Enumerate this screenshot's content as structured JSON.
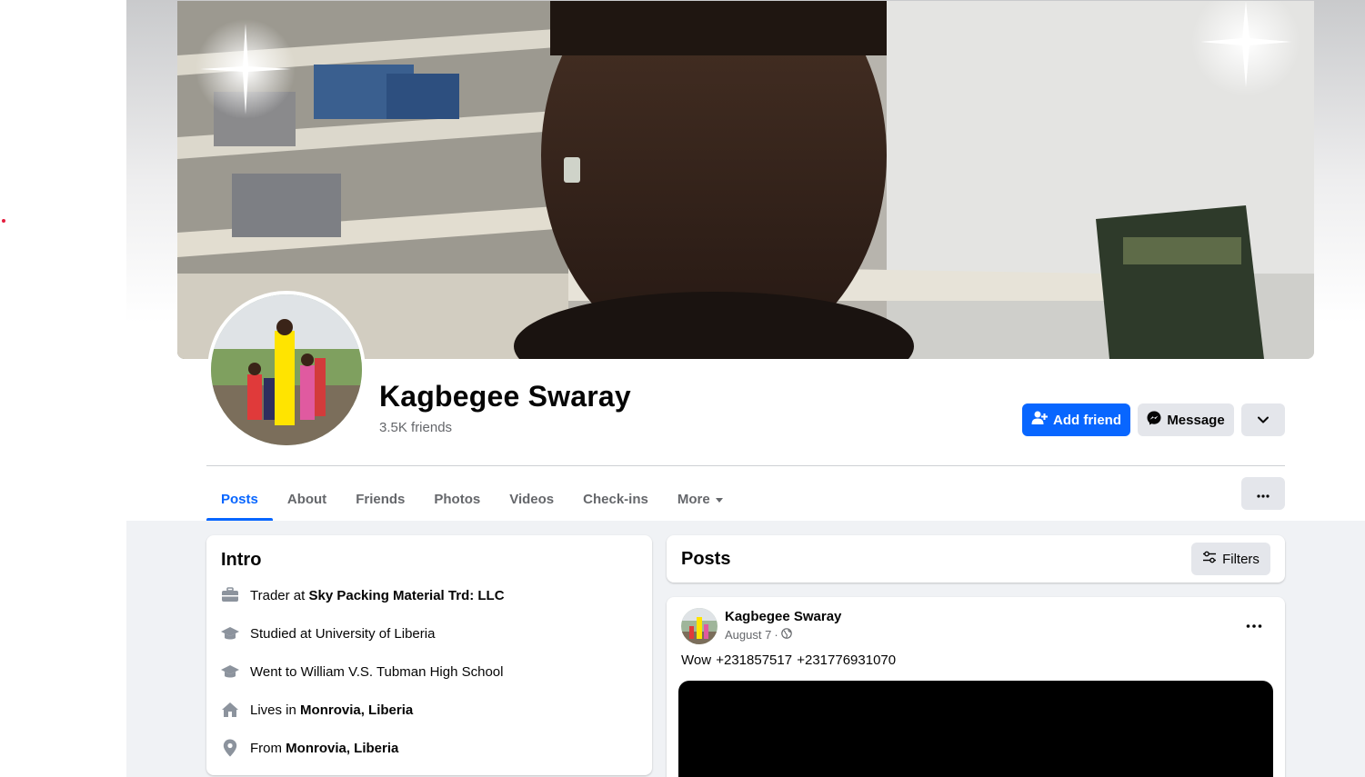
{
  "profile": {
    "name": "Kagbegee Swaray",
    "friends": "3.5K friends"
  },
  "actions": {
    "add_friend": "Add friend",
    "message": "Message"
  },
  "tabs": [
    {
      "label": "Posts",
      "active": true
    },
    {
      "label": "About",
      "active": false
    },
    {
      "label": "Friends",
      "active": false
    },
    {
      "label": "Photos",
      "active": false
    },
    {
      "label": "Videos",
      "active": false
    },
    {
      "label": "Check-ins",
      "active": false
    },
    {
      "label": "More",
      "active": false
    }
  ],
  "intro": {
    "title": "Intro",
    "items": [
      {
        "icon": "briefcase-icon",
        "prefix": "Trader at ",
        "bold": "Sky Packing Material Trd: LLC"
      },
      {
        "icon": "graduation-cap-icon",
        "prefix": "Studied at University of Liberia",
        "bold": ""
      },
      {
        "icon": "graduation-cap-icon",
        "prefix": "Went to William V.S. Tubman High School",
        "bold": ""
      },
      {
        "icon": "home-icon",
        "prefix": "Lives in ",
        "bold": "Monrovia, Liberia"
      },
      {
        "icon": "location-pin-icon",
        "prefix": "From ",
        "bold": "Monrovia, Liberia"
      }
    ]
  },
  "posts_section": {
    "title": "Posts",
    "filters_label": "Filters"
  },
  "post": {
    "author": "Kagbegee Swaray",
    "date": "August 7",
    "separator": "·",
    "text": "Wow +231857517  +231776931070"
  },
  "colors": {
    "accent": "#0866ff",
    "secondary_button": "#e4e6eb",
    "background": "#f0f2f5",
    "muted_text": "#65676b"
  }
}
